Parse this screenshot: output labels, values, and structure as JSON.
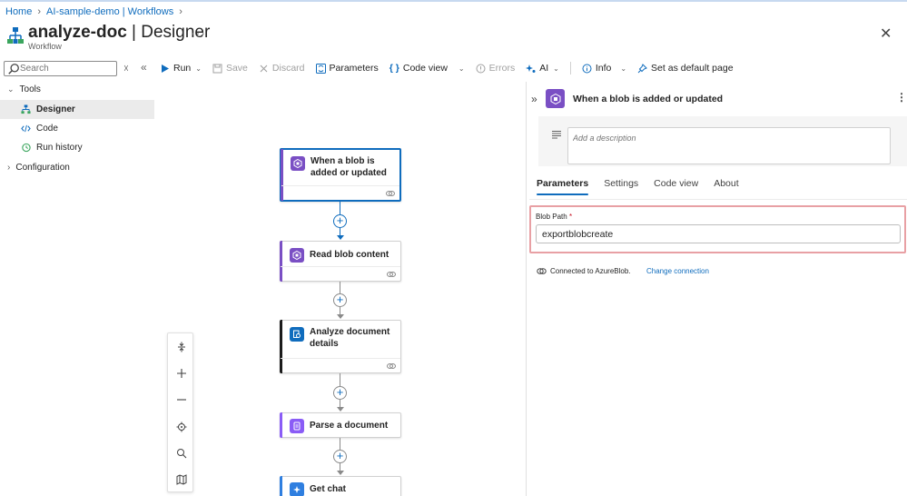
{
  "breadcrumb": {
    "home": "Home",
    "app": "AI-sample-demo | Workflows"
  },
  "header": {
    "name": "analyze-doc",
    "separator": "|",
    "view": "Designer",
    "subtitle": "Workflow",
    "more": "···",
    "close": "✕"
  },
  "sidebar": {
    "search_placeholder": "Search",
    "groups": [
      {
        "label": "Tools",
        "expanded": true
      },
      {
        "label": "Configuration",
        "expanded": false
      }
    ],
    "items": [
      {
        "label": "Designer",
        "icon": "designer-icon",
        "active": true
      },
      {
        "label": "Code",
        "icon": "code-icon"
      },
      {
        "label": "Run history",
        "icon": "history-icon"
      }
    ]
  },
  "toolbar": {
    "run": "Run",
    "save": "Save",
    "discard": "Discard",
    "parameters": "Parameters",
    "code_view": "Code view",
    "errors": "Errors",
    "ai": "AI",
    "info": "Info",
    "default_page": "Set as default page"
  },
  "nodes": [
    {
      "label": "When a blob is added or updated",
      "icon": "blob-trigger-icon",
      "color": "#7a4fc4"
    },
    {
      "label": "Read blob content",
      "icon": "blob-icon",
      "color": "#7a4fc4"
    },
    {
      "label": "Analyze document details",
      "icon": "document-analysis-icon",
      "color": "#0f6cbd"
    },
    {
      "label": "Parse a document",
      "icon": "parse-document-icon",
      "color": "#8a5cf6"
    },
    {
      "label": "Get chat completions",
      "icon": "openai-icon",
      "color": "#2f7fe0"
    }
  ],
  "panel": {
    "title": "When a blob is added or updated",
    "description_placeholder": "Add a description",
    "tabs": [
      "Parameters",
      "Settings",
      "Code view",
      "About"
    ],
    "active_tab": "Parameters",
    "field_label": "Blob Path",
    "required_mark": "*",
    "field_value": "exportblobcreate",
    "connection_text": "Connected to AzureBlob.",
    "change_connection": "Change connection"
  },
  "colors": {
    "accent": "#0f6cbd",
    "highlight_border": "#e8a0a4",
    "blob_purple": "#7a4fc4"
  }
}
